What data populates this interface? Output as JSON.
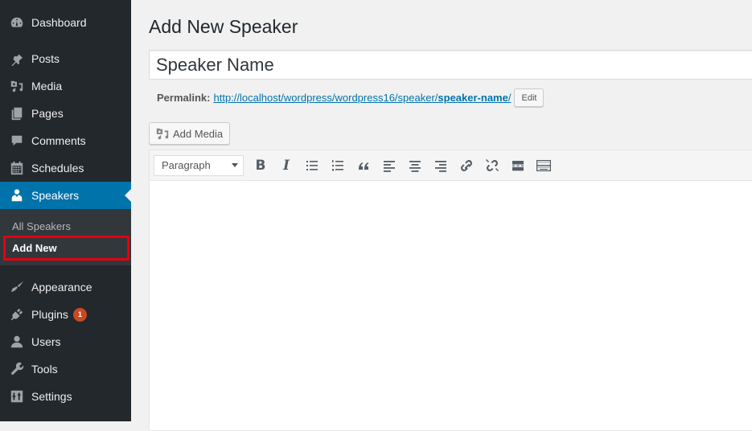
{
  "sidebar": {
    "items": [
      {
        "label": "Dashboard",
        "icon": "dashboard-icon"
      },
      {
        "label": "Posts",
        "icon": "pin-icon"
      },
      {
        "label": "Media",
        "icon": "media-icon"
      },
      {
        "label": "Pages",
        "icon": "pages-icon"
      },
      {
        "label": "Comments",
        "icon": "comment-icon"
      },
      {
        "label": "Schedules",
        "icon": "calendar-icon"
      },
      {
        "label": "Speakers",
        "icon": "user-icon",
        "active": true
      },
      {
        "label": "Appearance",
        "icon": "paintbrush-icon"
      },
      {
        "label": "Plugins",
        "icon": "plug-icon",
        "badge": "1"
      },
      {
        "label": "Users",
        "icon": "users-icon"
      },
      {
        "label": "Tools",
        "icon": "wrench-icon"
      },
      {
        "label": "Settings",
        "icon": "settings-icon"
      }
    ],
    "submenu": [
      {
        "label": "All Speakers"
      },
      {
        "label": "Add New",
        "current": true
      }
    ]
  },
  "main": {
    "page_title": "Add New Speaker",
    "title_input_value": "Speaker Name",
    "permalink": {
      "label": "Permalink:",
      "url_base": "http://localhost/wordpress/wordpress16/speaker/",
      "url_slug": "speaker-name",
      "url_trailing": "/",
      "edit_label": "Edit"
    },
    "add_media_label": "Add Media",
    "editor": {
      "format_select": "Paragraph",
      "bold_glyph": "B",
      "italic_glyph": "I",
      "toolbar_buttons": [
        "bold",
        "italic",
        "bulleted-list",
        "numbered-list",
        "blockquote",
        "align-left",
        "align-center",
        "align-right",
        "insert-link",
        "remove-link",
        "read-more",
        "toolbar-toggle"
      ]
    }
  },
  "colors": {
    "sidebar_bg": "#23282d",
    "active_bg": "#0073aa",
    "submenu_bg": "#32373c",
    "highlight": "#e3000f",
    "badge": "#ca4a1f",
    "link": "#0073aa"
  }
}
